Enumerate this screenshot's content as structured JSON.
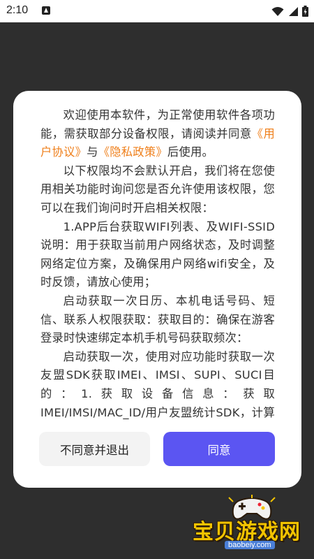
{
  "status_bar": {
    "time": "2:10",
    "notification_icon": "a-notification-icon",
    "icons": [
      "wifi-icon",
      "signal-icon",
      "battery-icon"
    ]
  },
  "dialog": {
    "paragraphs": [
      {
        "parts": [
          {
            "text": "欢迎使用本软件，为正常使用软件各项功能，需获取部分设备权限，请阅读并同意",
            "link": false
          },
          {
            "text": "《用户协议》",
            "link": true
          },
          {
            "text": "与",
            "link": false
          },
          {
            "text": "《隐私政策》",
            "link": true
          },
          {
            "text": "后使用。",
            "link": false
          }
        ]
      },
      {
        "parts": [
          {
            "text": "以下权限均不会默认开启，我们将在您使用相关功能时询问您是否允许使用该权限，您可以在我们询问时开启相关权限：",
            "link": false
          }
        ]
      },
      {
        "parts": [
          {
            "text": "1.APP后台获取WIFI列表、及WIFI-SSID说明：用于获取当前用户网络状态，及时调整网络定位方案，及确保用户网络wifi安全，及时反馈，请放心使用；",
            "link": false
          }
        ]
      },
      {
        "parts": [
          {
            "text": "启动获取一次日历、本机电话号码、短信、联系人权限获取：获取目的：确保在游客登录时快速绑定本机手机号码获取频次：",
            "link": false
          }
        ]
      },
      {
        "parts": [
          {
            "text": "启动获取一次，使用对应功能时获取一次友盟SDK获取IMEI、IMSI、SUPI、SUCI目的：1.获取设备信息：获取IMEI/IMSI/MAC_ID/用户友盟统计SDK，计算设备和用户数据",
            "link": false
          }
        ]
      }
    ],
    "decline_label": "不同意并退出",
    "agree_label": "同意"
  },
  "watermark": {
    "logo_text": "宝贝游戏网",
    "url": "baobeiy.com"
  },
  "colors": {
    "link": "#ef7f1a",
    "agree_button": "#5b55f2",
    "decline_button": "#f3f3f3",
    "backdrop": "#2e2e2e"
  }
}
